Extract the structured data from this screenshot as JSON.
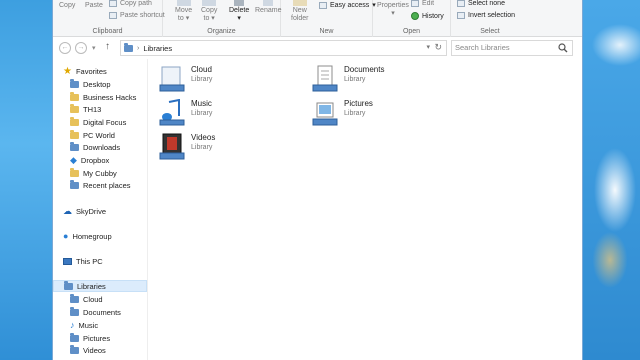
{
  "ribbon": {
    "clipboard": {
      "label": "Clipboard",
      "copy": "Copy",
      "paste": "Paste",
      "copy_path": "Copy path",
      "paste_shortcut": "Paste shortcut"
    },
    "organize": {
      "label": "Organize",
      "move_to": [
        "Move",
        "to"
      ],
      "copy_to": [
        "Copy",
        "to"
      ],
      "delete": "Delete",
      "rename": "Rename"
    },
    "new": {
      "label": "New",
      "new_folder": [
        "New",
        "folder"
      ],
      "easy_access": "Easy access"
    },
    "open": {
      "label": "Open",
      "properties": "Properties",
      "edit": "Edit",
      "history": "History"
    },
    "select": {
      "label": "Select",
      "select_none": "Select none",
      "invert_selection": "Invert selection"
    }
  },
  "address": {
    "path": "Libraries",
    "search_placeholder": "Search Libraries"
  },
  "nav_pane": {
    "favorites_label": "Favorites",
    "favorites": [
      "Desktop",
      "Business Hacks",
      "TH13",
      "Digital Focus",
      "PC World",
      "Downloads",
      "Dropbox",
      "My Cubby",
      "Recent places"
    ],
    "skydrive": "SkyDrive",
    "homegroup": "Homegroup",
    "this_pc": "This PC",
    "libraries_label": "Libraries",
    "libraries": [
      "Cloud",
      "Documents",
      "Music",
      "Pictures",
      "Videos"
    ]
  },
  "content": {
    "items": [
      {
        "name": "Cloud",
        "type": "Library",
        "icon": "cloud-library-icon"
      },
      {
        "name": "Documents",
        "type": "Library",
        "icon": "documents-library-icon"
      },
      {
        "name": "Music",
        "type": "Library",
        "icon": "music-library-icon"
      },
      {
        "name": "Pictures",
        "type": "Library",
        "icon": "pictures-library-icon"
      },
      {
        "name": "Videos",
        "type": "Library",
        "icon": "videos-library-icon"
      }
    ]
  },
  "colors": {
    "selection": "#dcecfc",
    "accent": "#3d9fe0",
    "folder": "#e7c15a"
  }
}
